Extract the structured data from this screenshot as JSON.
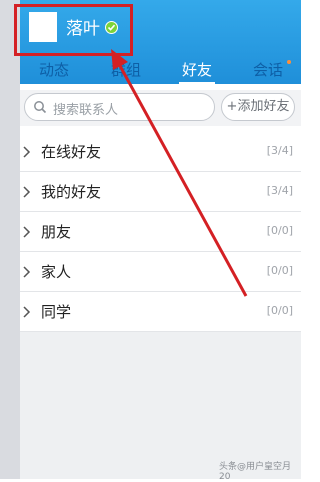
{
  "header": {
    "username": "落叶"
  },
  "tabs": [
    {
      "label": "动态"
    },
    {
      "label": "群组"
    },
    {
      "label": "好友"
    },
    {
      "label": "会话"
    }
  ],
  "search": {
    "placeholder": "搜索联系人",
    "add_button_label": "+添加好友"
  },
  "groups": [
    {
      "name": "在线好友",
      "count": "[3/4]"
    },
    {
      "name": "我的好友",
      "count": "[3/4]"
    },
    {
      "name": "朋友",
      "count": "[0/0]"
    },
    {
      "name": "家人",
      "count": "[0/0]"
    },
    {
      "name": "同学",
      "count": "[0/0]"
    }
  ],
  "watermark": "头条@用户皇空月20",
  "colors": {
    "header_blue": "#2a9de3",
    "annotation_red": "#d42024",
    "status_green": "#7dd33a"
  }
}
